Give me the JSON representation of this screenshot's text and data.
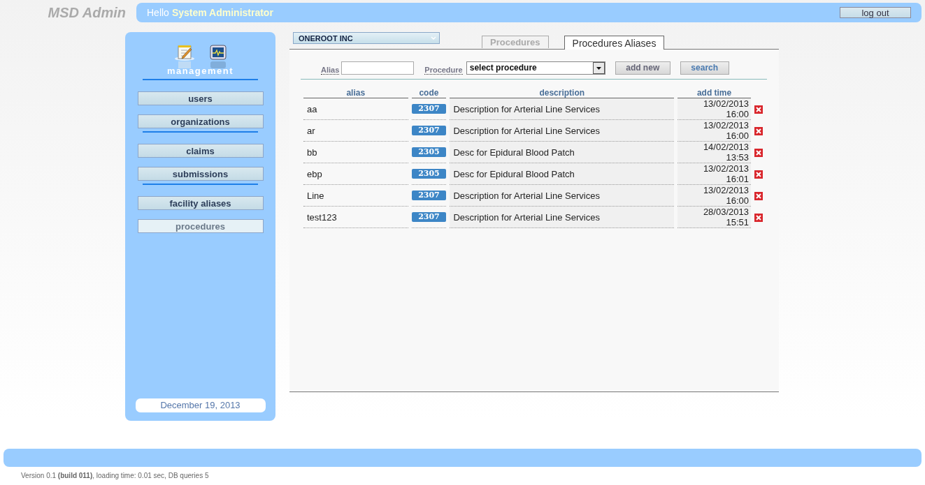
{
  "app_title": "MSD Admin",
  "greeting": {
    "prefix": "Hello",
    "user": "System Administrator"
  },
  "logout": "log out",
  "sidebar": {
    "section": "management",
    "groups": [
      [
        {
          "label": "users",
          "selected": false
        },
        {
          "label": "organizations",
          "selected": false
        }
      ],
      [
        {
          "label": "claims",
          "selected": false
        },
        {
          "label": "submissions",
          "selected": false
        }
      ],
      [
        {
          "label": "facility aliases",
          "selected": false
        },
        {
          "label": "procedures",
          "selected": true
        }
      ]
    ],
    "date": "December 19, 2013"
  },
  "organization": "ONEROOT INC",
  "tabs": [
    {
      "label": "Procedures",
      "selected": false
    },
    {
      "label": "Procedures Aliases",
      "selected": true
    }
  ],
  "filters": {
    "alias_label": "Alias",
    "procedure_label": "Procedure",
    "procedure_value": "select procedure",
    "buttons": [
      "add new",
      "search"
    ]
  },
  "table": {
    "columns": [
      "alias",
      "code",
      "description",
      "add time"
    ],
    "rows": [
      {
        "alias": "aa",
        "code": "2307",
        "description": "Description for Arterial Line Services",
        "add_time": "13/02/2013 16:00"
      },
      {
        "alias": "ar",
        "code": "2307",
        "description": "Description for Arterial Line Services",
        "add_time": "13/02/2013 16:00"
      },
      {
        "alias": "bb",
        "code": "2305",
        "description": "Desc for Epidural Blood Patch",
        "add_time": "14/02/2013 13:53"
      },
      {
        "alias": "ebp",
        "code": "2305",
        "description": "Desc for Epidural Blood Patch",
        "add_time": "13/02/2013 16:01"
      },
      {
        "alias": "Line",
        "code": "2307",
        "description": "Description for Arterial Line Services",
        "add_time": "13/02/2013 16:00"
      },
      {
        "alias": "test123",
        "code": "2307",
        "description": "Description for Arterial Line Services",
        "add_time": "28/03/2013 15:51"
      }
    ]
  },
  "footer": "Version 0.1 **(build 011)**, loading time: 0.01 sec, DB queries 5"
}
